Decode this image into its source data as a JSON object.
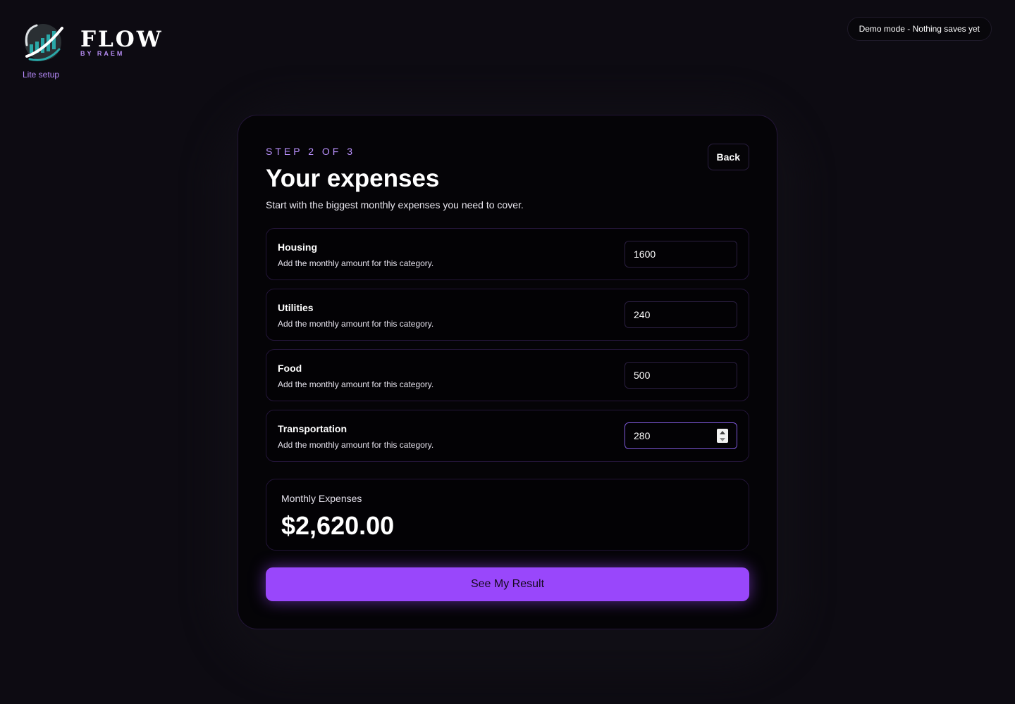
{
  "brand": {
    "name": "FLOW",
    "sub": "BY RAEM",
    "setup": "Lite setup",
    "logo_icon": "flow-logo-icon"
  },
  "demo_pill": "Demo mode - Nothing saves yet",
  "card": {
    "step": "STEP 2 OF 3",
    "title": "Your expenses",
    "subtitle": "Start with the biggest monthly expenses you need to cover.",
    "back_label": "Back",
    "rows": [
      {
        "label": "Housing",
        "help": "Add the monthly amount for this category.",
        "value": "1600"
      },
      {
        "label": "Utilities",
        "help": "Add the monthly amount for this category.",
        "value": "240"
      },
      {
        "label": "Food",
        "help": "Add the monthly amount for this category.",
        "value": "500"
      },
      {
        "label": "Transportation",
        "help": "Add the monthly amount for this category.",
        "value": "280"
      }
    ],
    "total_label": "Monthly Expenses",
    "total_value": "$2,620.00",
    "cta_label": "See My Result"
  },
  "colors": {
    "background": "#0d0b12",
    "accent": "#9947fb",
    "accent_text": "#bb92ff"
  }
}
